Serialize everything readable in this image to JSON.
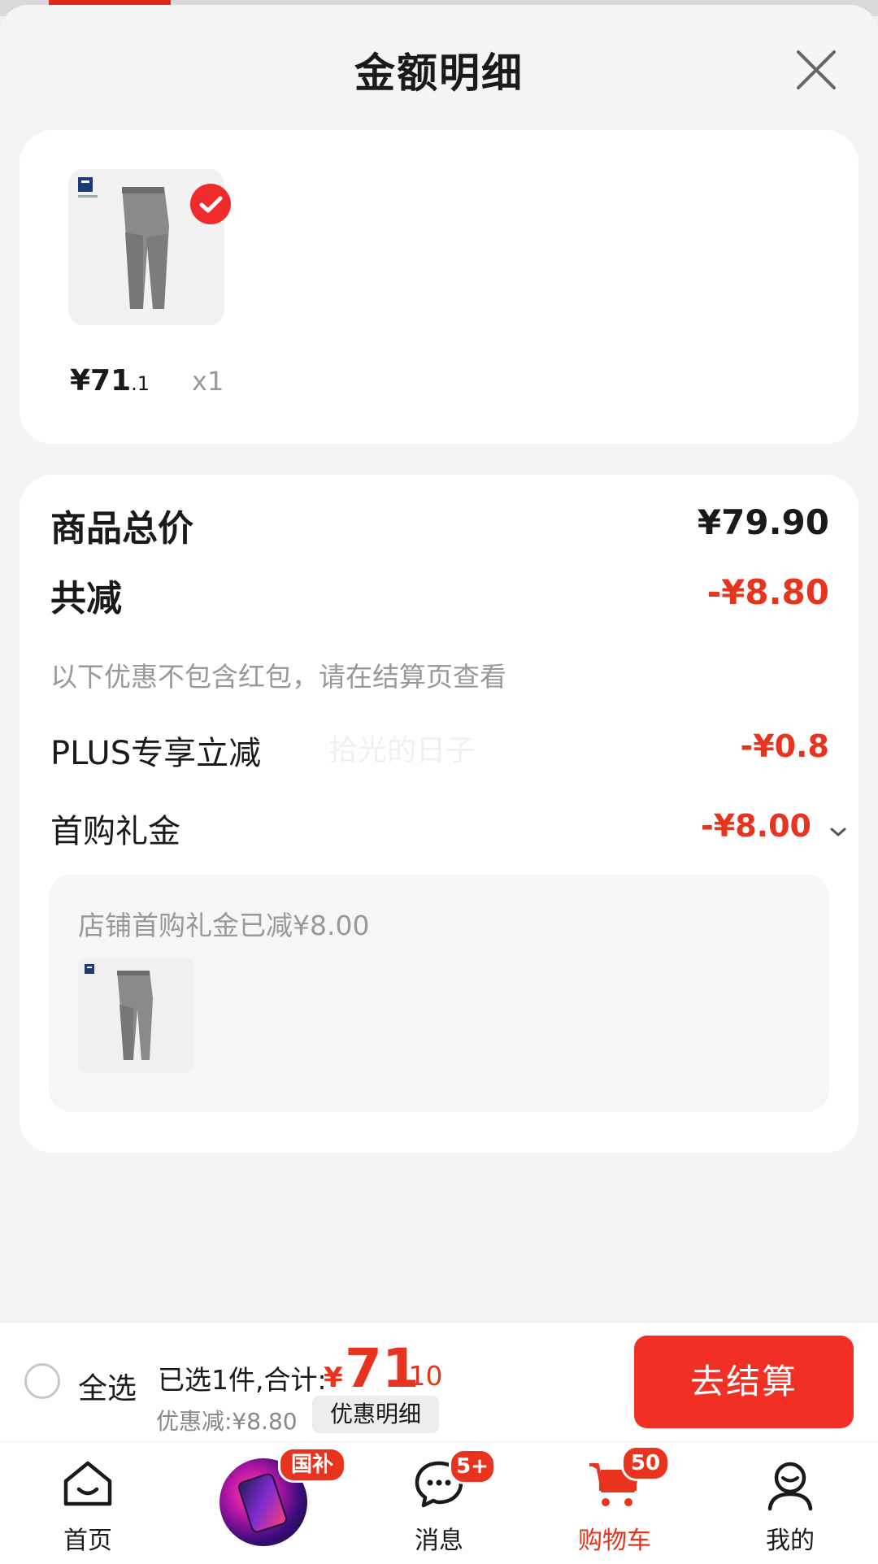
{
  "sheet": {
    "title": "金额明细",
    "close_icon": "close-icon"
  },
  "item": {
    "price_main": "¥71",
    "price_decimal": ".1",
    "quantity": "x1",
    "selected": true
  },
  "summary": {
    "total_label": "商品总价",
    "total_value": "¥79.90",
    "reduce_label": "共减",
    "reduce_value": "-¥8.80",
    "note": "以下优惠不包含红包，请在结算页查看",
    "watermark": "拾光的日子",
    "plus_label": "PLUS专享立减",
    "plus_value": "-¥0.8",
    "gift_label": "首购礼金",
    "gift_value": "-¥8.00",
    "gift_detail": "店铺首购礼金已减¥8.00"
  },
  "checkout": {
    "select_all": "全选",
    "selected_text": "已选1件,合计:",
    "currency": "¥",
    "total_int": "71",
    "total_dec": ".10",
    "discount_text": "优惠减:¥8.80",
    "discount_detail_btn": "优惠明细",
    "checkout_btn": "去结算"
  },
  "tabs": [
    {
      "label": "首页",
      "icon": "home-icon"
    },
    {
      "label": "",
      "icon": "promo-icon",
      "badge": "国补"
    },
    {
      "label": "消息",
      "icon": "message-icon",
      "badge": "5+"
    },
    {
      "label": "购物车",
      "icon": "cart-icon",
      "badge": "50",
      "active": true
    },
    {
      "label": "我的",
      "icon": "profile-icon"
    }
  ],
  "colors": {
    "accent": "#e8331f",
    "checkout_button": "#f12f24",
    "background": "#f4f4f4"
  }
}
